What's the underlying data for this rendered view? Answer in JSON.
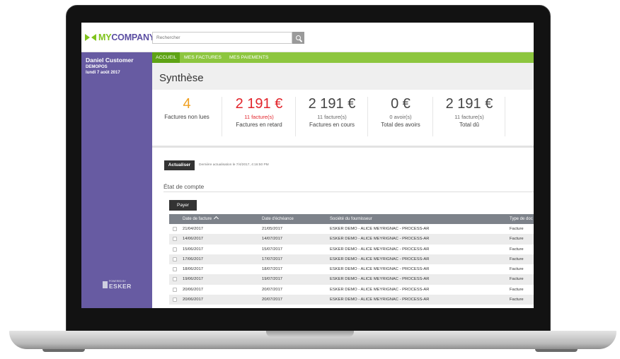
{
  "app": {
    "logo_my": "MY",
    "logo_company": "COMPANY",
    "search_placeholder": "Rechercher"
  },
  "sidebar": {
    "user_name": "Daniel Customer",
    "company": "DEMOPOS",
    "date": "lundi 7 août 2017",
    "powered_by": "POWERED BY",
    "esker": "ESKER"
  },
  "nav": {
    "items": [
      {
        "label": "ACCUEIL",
        "active": true
      },
      {
        "label": "MES FACTURES",
        "active": false
      },
      {
        "label": "MES PAIEMENTS",
        "active": false
      }
    ]
  },
  "page": {
    "title": "Synthèse"
  },
  "stats": [
    {
      "value": "4",
      "sub": "",
      "label": "Factures non lues",
      "color": "#f0a020"
    },
    {
      "value": "2 191 €",
      "sub": "11 facture(s)",
      "label": "Factures en retard",
      "color": "#e2242b"
    },
    {
      "value": "2 191 €",
      "sub": "11 facture(s)",
      "label": "Factures en cours",
      "color": "#444444"
    },
    {
      "value": "0 €",
      "sub": "0 avoir(s)",
      "label": "Total des avoirs",
      "color": "#444444"
    },
    {
      "value": "2 191 €",
      "sub": "11 facture(s)",
      "label": "Total dû",
      "color": "#444444"
    }
  ],
  "actions": {
    "refresh_label": "Actualiser",
    "last_refresh": "Dernière actualisation le 7/4/2017, 4:16:50 PM",
    "section_title": "État de compte",
    "pay_label": "Payer"
  },
  "table": {
    "columns": [
      "Date de facture",
      "Date d'échéance",
      "Société du fournisseur",
      "Type de doc"
    ],
    "rows": [
      [
        "21/04/2017",
        "21/05/2017",
        "ESKER DEMO - ALICE MEYRIGNAC - PROCESS-AR",
        "Facture"
      ],
      [
        "14/06/2017",
        "14/07/2017",
        "ESKER DEMO - ALICE MEYRIGNAC - PROCESS-AR",
        "Facture"
      ],
      [
        "15/06/2017",
        "15/07/2017",
        "ESKER DEMO - ALICE MEYRIGNAC - PROCESS-AR",
        "Facture"
      ],
      [
        "17/06/2017",
        "17/07/2017",
        "ESKER DEMO - ALICE MEYRIGNAC - PROCESS-AR",
        "Facture"
      ],
      [
        "18/06/2017",
        "18/07/2017",
        "ESKER DEMO - ALICE MEYRIGNAC - PROCESS-AR",
        "Facture"
      ],
      [
        "19/06/2017",
        "19/07/2017",
        "ESKER DEMO - ALICE MEYRIGNAC - PROCESS-AR",
        "Facture"
      ],
      [
        "20/06/2017",
        "20/07/2017",
        "ESKER DEMO - ALICE MEYRIGNAC - PROCESS-AR",
        "Facture"
      ],
      [
        "20/06/2017",
        "20/07/2017",
        "ESKER DEMO - ALICE MEYRIGNAC - PROCESS-AR",
        "Facture"
      ]
    ]
  },
  "colors": {
    "brand_green": "#8dc63f",
    "brand_purple": "#675ba2",
    "alert_red": "#e2242b",
    "accent_orange": "#f0a020"
  }
}
